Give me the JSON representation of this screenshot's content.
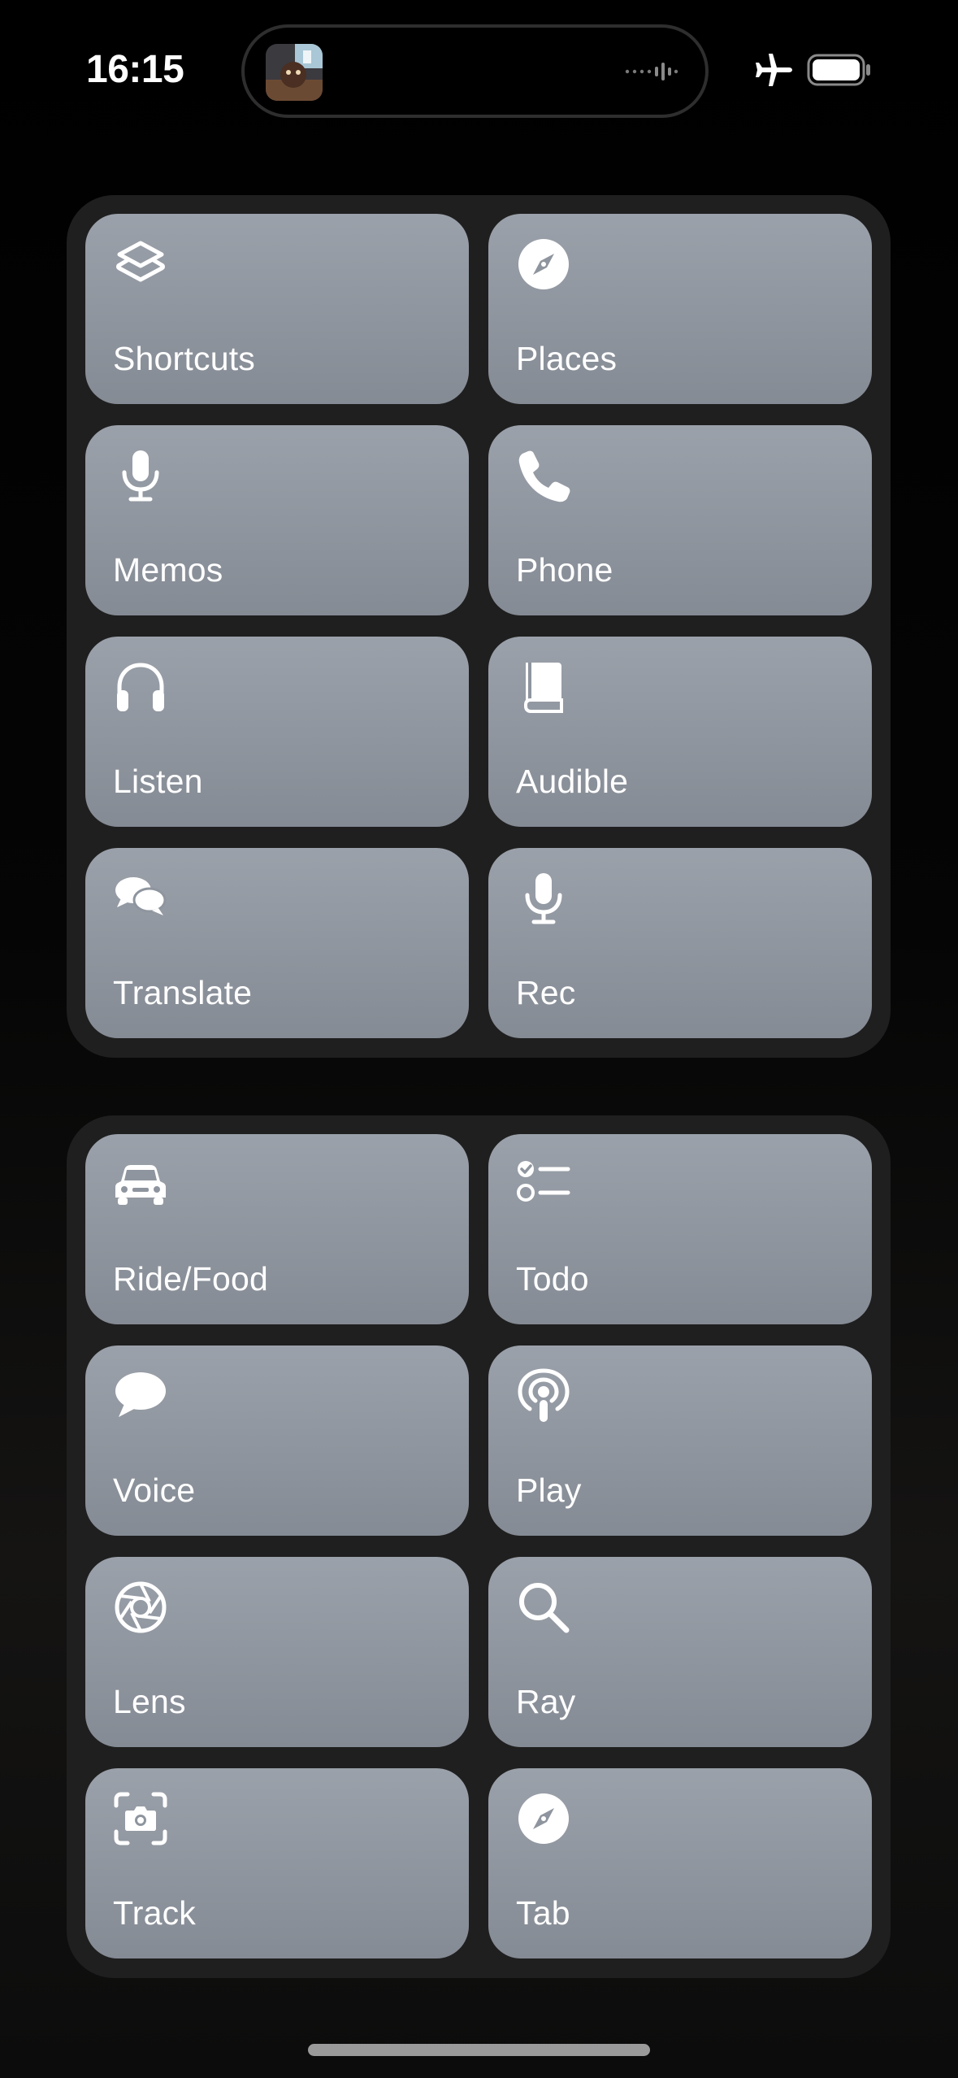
{
  "status_bar": {
    "time": "16:15",
    "airplane_mode": true,
    "battery": "battery-full-icon"
  },
  "dynamic_island": {
    "now_playing_art": "album-art",
    "activity": "audio-waveform-icon"
  },
  "panels": [
    {
      "name": "top",
      "tiles": [
        {
          "label": "Shortcuts",
          "icon": "shortcuts-icon"
        },
        {
          "label": "Places",
          "icon": "compass-icon"
        },
        {
          "label": "Memos",
          "icon": "microphone-icon"
        },
        {
          "label": "Phone",
          "icon": "phone-icon"
        },
        {
          "label": "Listen",
          "icon": "headphones-icon"
        },
        {
          "label": "Audible",
          "icon": "book-icon"
        },
        {
          "label": "Translate",
          "icon": "chat-bubbles-icon"
        },
        {
          "label": "Rec",
          "icon": "microphone-icon"
        }
      ]
    },
    {
      "name": "bottom",
      "tiles": [
        {
          "label": "Ride/Food",
          "icon": "car-icon"
        },
        {
          "label": "Todo",
          "icon": "checklist-icon"
        },
        {
          "label": "Voice",
          "icon": "speech-bubble-icon"
        },
        {
          "label": "Play",
          "icon": "podcast-icon"
        },
        {
          "label": "Lens",
          "icon": "aperture-icon"
        },
        {
          "label": "Ray",
          "icon": "magnifying-glass-icon"
        },
        {
          "label": "Track",
          "icon": "camera-viewfinder-icon"
        },
        {
          "label": "Tab",
          "icon": "compass-icon"
        }
      ]
    }
  ],
  "colors": {
    "background": "#000000",
    "panel": "#1f1f1f",
    "tile_top": "#9ba1aa",
    "tile_bottom": "#858b94",
    "text": "#ffffff"
  }
}
